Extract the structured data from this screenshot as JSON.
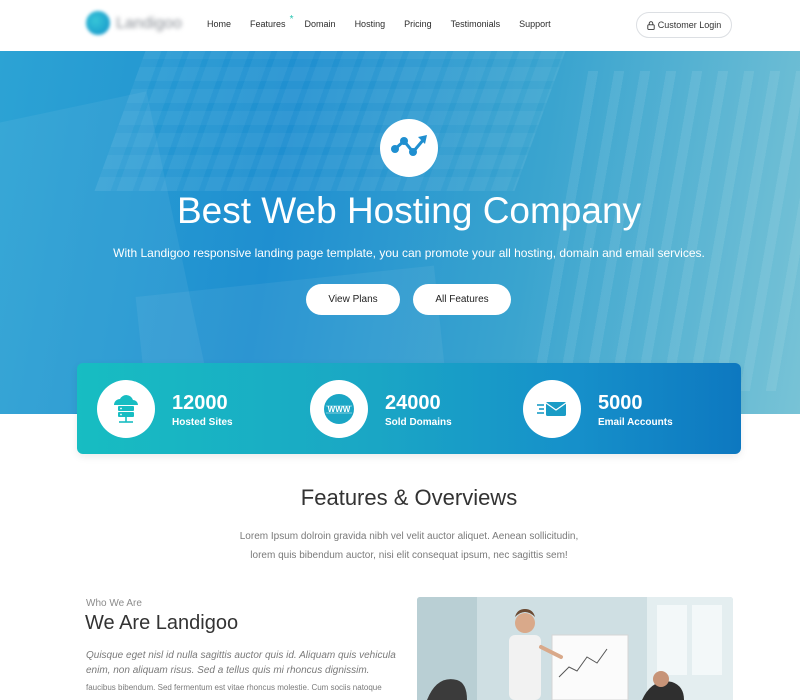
{
  "nav": {
    "logo_text": "Landigoo",
    "items": [
      {
        "label": "Home"
      },
      {
        "label": "Features",
        "badge": "*"
      },
      {
        "label": "Domain"
      },
      {
        "label": "Hosting"
      },
      {
        "label": "Pricing"
      },
      {
        "label": "Testimonials"
      },
      {
        "label": "Support"
      }
    ],
    "login_label": "Customer Login"
  },
  "hero": {
    "title": "Best Web Hosting Company",
    "subtitle": "With Landigoo responsive landing page template, you can promote your all hosting, domain and email services.",
    "btn_plans": "View Plans",
    "btn_features": "All Features"
  },
  "stats": [
    {
      "value": "12000",
      "label": "Hosted Sites",
      "icon": "server-cloud-icon"
    },
    {
      "value": "24000",
      "label": "Sold Domains",
      "icon": "www-globe-icon"
    },
    {
      "value": "5000",
      "label": "Email Accounts",
      "icon": "email-fast-icon"
    }
  ],
  "features": {
    "title": "Features & Overviews",
    "desc_line1": "Lorem Ipsum dolroin gravida nibh vel velit auctor aliquet. Aenean sollicitudin,",
    "desc_line2": "lorem quis bibendum auctor, nisi elit consequat ipsum, nec sagittis sem!"
  },
  "who": {
    "eyebrow": "Who We Are",
    "title": "We Are Landigoo",
    "lead_line1": "Quisque eget nisl id nulla sagittis auctor quis id. Aliquam quis vehicula",
    "lead_line2": "enim, non aliquam risus. Sed a tellus quis mi rhoncus dignissim.",
    "body": "faucibus bibendum. Sed fermentum est vitae rhoncus molestie. Cum sociis natoque"
  },
  "colors": {
    "accent": "#1aa6c5",
    "hero_blue": "#1f8fd0",
    "stats_start": "#17bdc2",
    "stats_end": "#0d78c0",
    "nav_badge": "#27c4b2"
  }
}
